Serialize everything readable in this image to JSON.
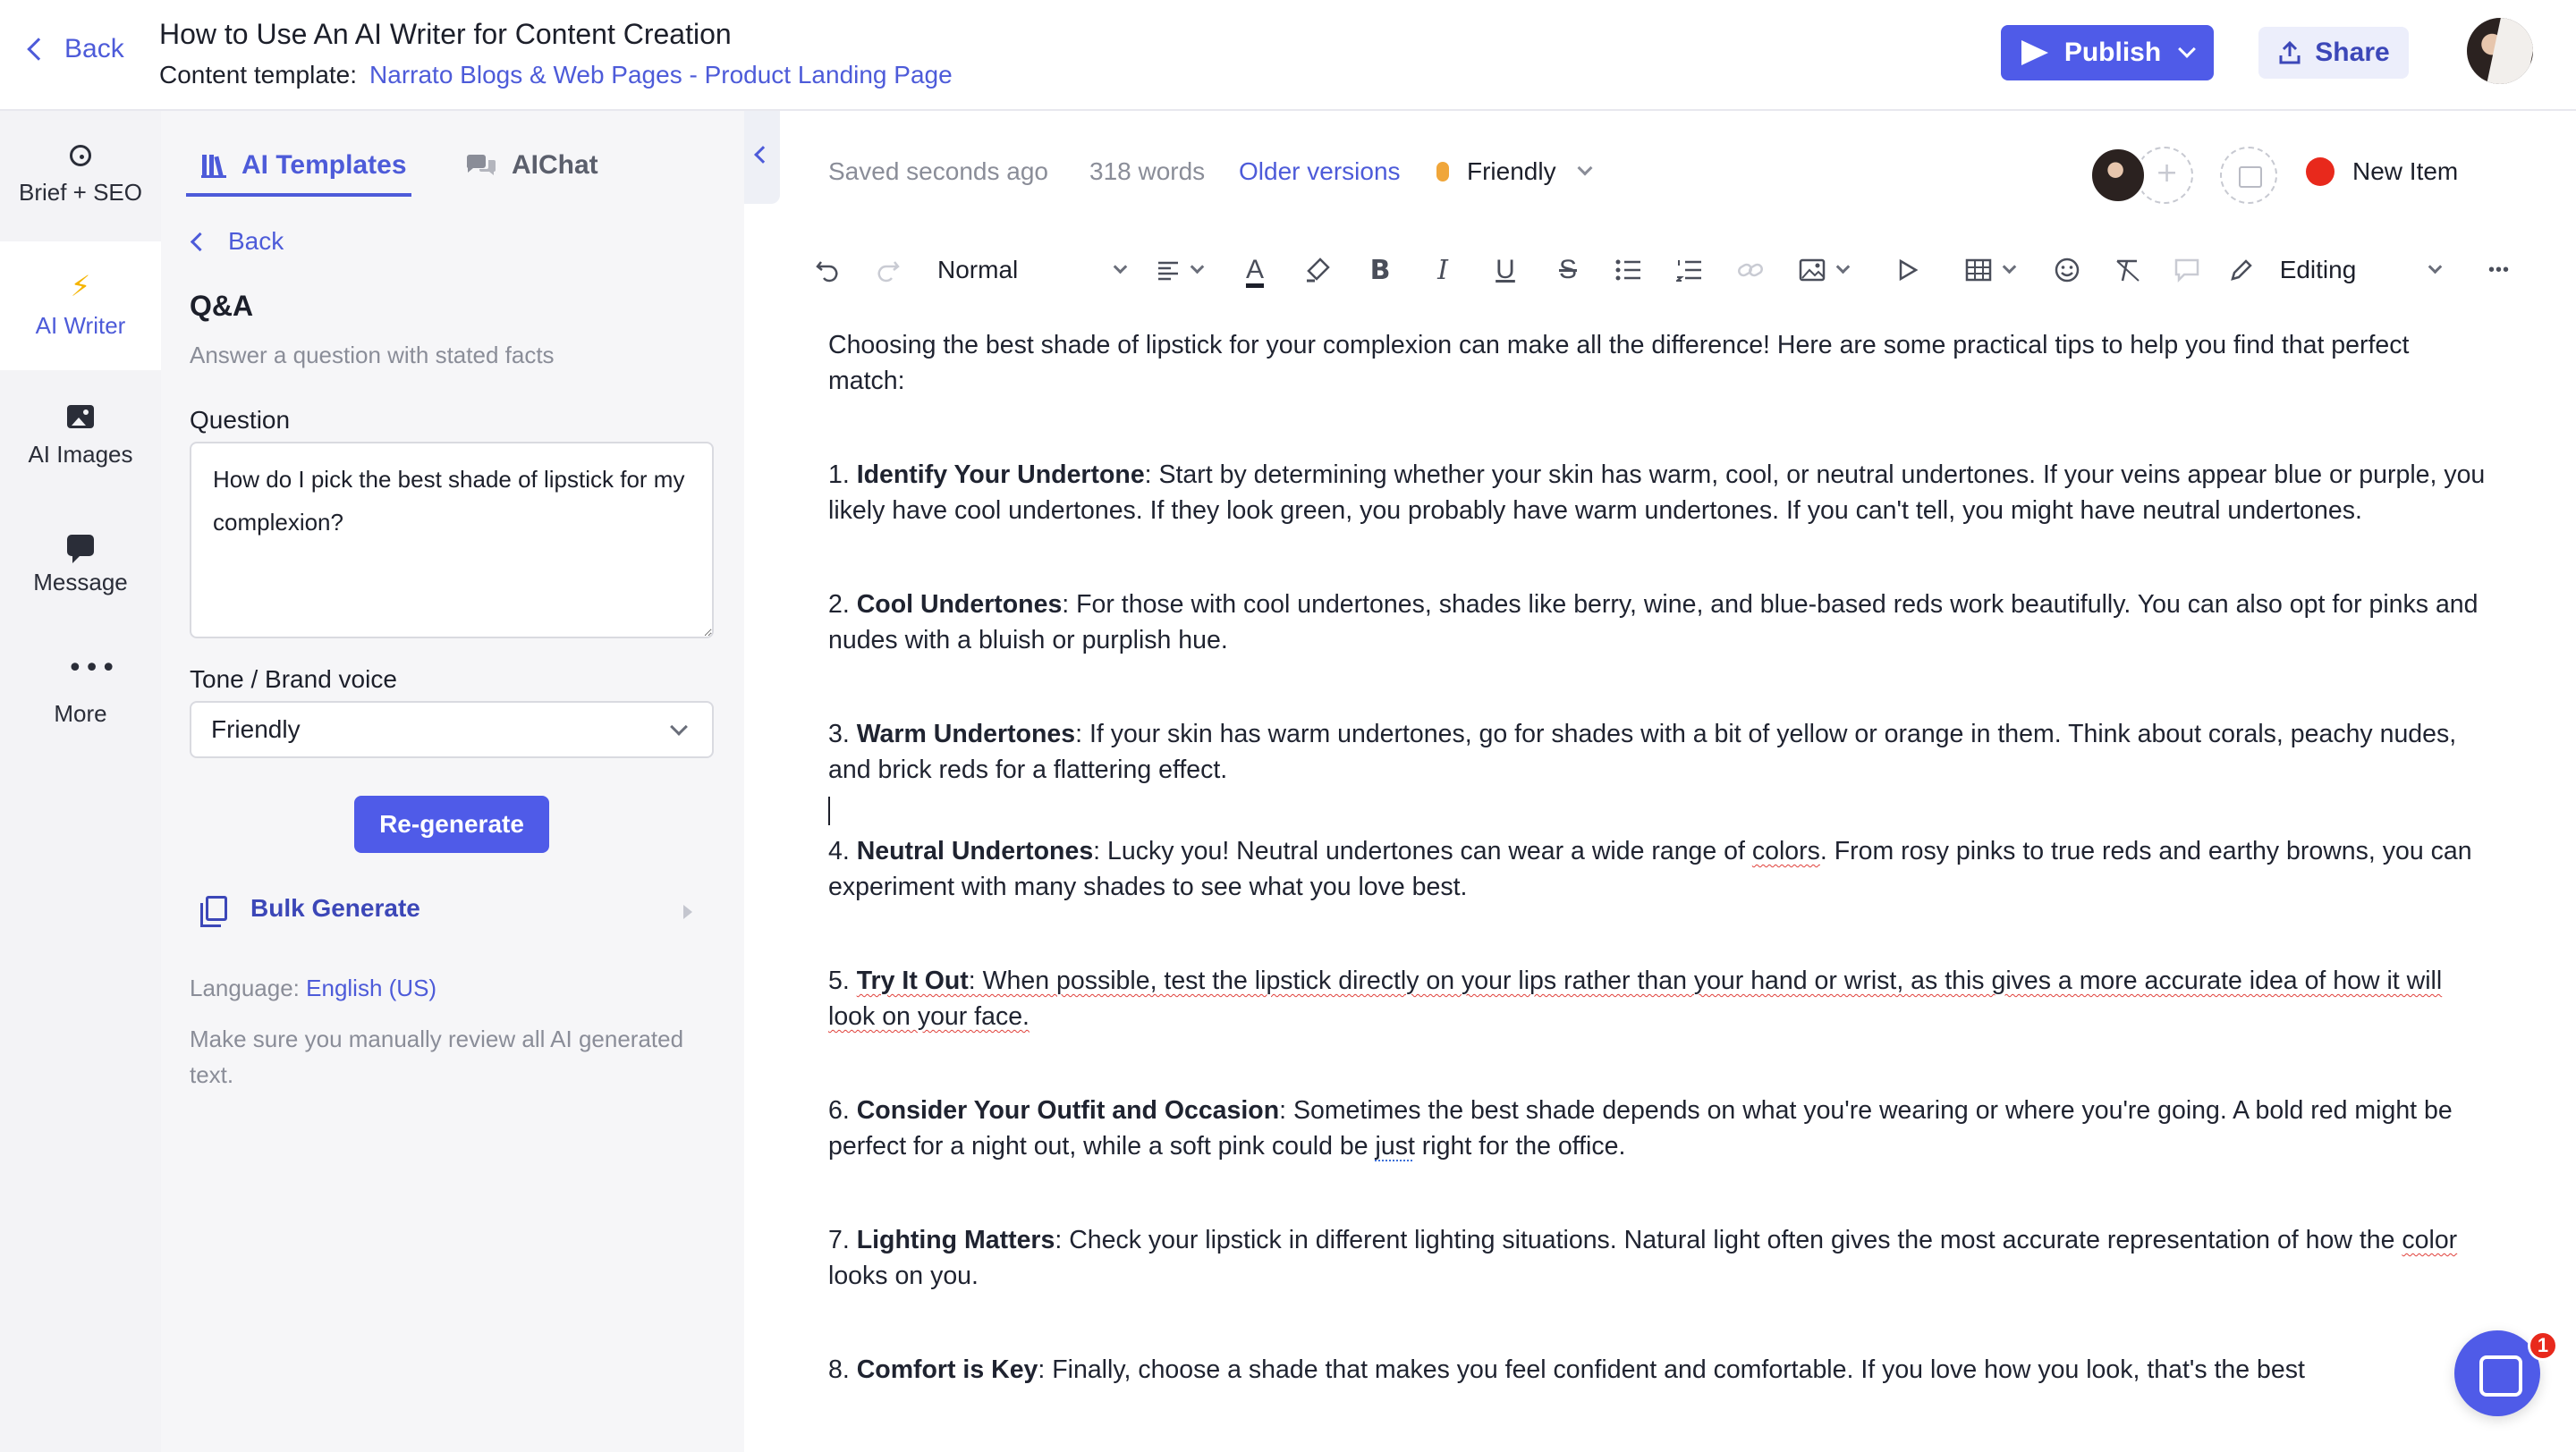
{
  "header": {
    "back_label": "Back",
    "title": "How to Use An AI Writer for Content Creation",
    "template_prefix": "Content template:",
    "template_name": "Narrato Blogs & Web Pages - Product Landing Page",
    "publish_label": "Publish",
    "share_label": "Share"
  },
  "rail": {
    "items": [
      {
        "label": "Brief + SEO",
        "icon": "target-icon"
      },
      {
        "label": "AI Writer",
        "icon": "bolt-icon"
      },
      {
        "label": "AI Images",
        "icon": "image-icon"
      },
      {
        "label": "Message",
        "icon": "message-icon"
      },
      {
        "label": "More",
        "icon": "more-icon"
      }
    ],
    "active": "AI Writer"
  },
  "panel": {
    "tabs": [
      {
        "label": "AI Templates",
        "icon": "library-icon"
      },
      {
        "label": "AIChat",
        "icon": "chat-icon"
      }
    ],
    "back_label": "Back",
    "template_title": "Q&A",
    "template_desc": "Answer a question with stated facts",
    "question_label": "Question",
    "question_value": "How do I pick the best shade of lipstick for my complexion?",
    "tone_label": "Tone / Brand voice",
    "tone_value": "Friendly",
    "regenerate_label": "Re-generate",
    "bulk_label": "Bulk Generate",
    "language_prefix": "Language:",
    "language_value": "English (US)",
    "review_note": "Make sure you manually review all AI generated text."
  },
  "editor": {
    "saved_status": "Saved seconds ago",
    "word_count": "318 words",
    "older_versions": "Older versions",
    "tone": "Friendly",
    "status_label": "New Item",
    "status_color": "#e8291c",
    "accent_color": "#4f5be8",
    "toolbar": {
      "style": "Normal",
      "font_color_glyph": "A",
      "bold_glyph": "B",
      "italic_glyph": "I",
      "underline_glyph": "U",
      "strike_glyph": "S",
      "mode": "Editing",
      "more_glyph": "•••"
    },
    "intro": "Choosing the best shade of lipstick for your complexion can make all the difference! Here are some practical tips to help you find that perfect match:",
    "tips": [
      {
        "num": "1.",
        "title": "Identify Your Undertone",
        "text": ": Start by determining whether your skin has warm, cool, or neutral undertones. If your veins appear blue or purple, you likely have cool undertones. If they look green, you probably have warm undertones. If you can't tell, you might have neutral undertones."
      },
      {
        "num": "2.",
        "title": "Cool Undertones",
        "text": ": For those with cool undertones, shades like berry, wine, and blue-based reds work beautifully. You can also opt for pinks and nudes with a bluish or purplish hue."
      },
      {
        "num": "3.",
        "title": "Warm Undertones",
        "text": ": If your skin has warm undertones, go for shades with a bit of yellow or orange in them. Think about corals, peachy nudes, and brick reds for a flattering effect."
      },
      {
        "num": "4.",
        "title": "Neutral Undertones",
        "text_a": ": Lucky you! Neutral undertones can wear a wide range of ",
        "word": "colors",
        "text_b": ". From rosy pinks to true reds and earthy browns, you can experiment with many shades to see what you love best."
      },
      {
        "num": "5.",
        "title": "Try It Out",
        "text": ": When possible, test the lipstick directly on your lips rather than your hand or wrist, as this gives a more accurate idea of how it will look on your face."
      },
      {
        "num": "6.",
        "title": "Consider Your Outfit and Occasion",
        "text_a": ": Sometimes the best shade depends on what you're wearing or where you're going. A bold red might be perfect for a night out, while a soft pink could be ",
        "word": "just",
        "text_b": " right for the office."
      },
      {
        "num": "7.",
        "title": "Lighting Matters",
        "text_a": ": Check your lipstick in different lighting situations. Natural light often gives the most accurate representation of how the ",
        "word": "color",
        "text_b": " looks on you."
      },
      {
        "num": "8.",
        "title": "Comfort is Key",
        "text": ": Finally, choose a shade that makes you feel confident and comfortable. If you love how you look, that's the best"
      }
    ]
  },
  "chat_widget": {
    "badge_count": "1"
  }
}
